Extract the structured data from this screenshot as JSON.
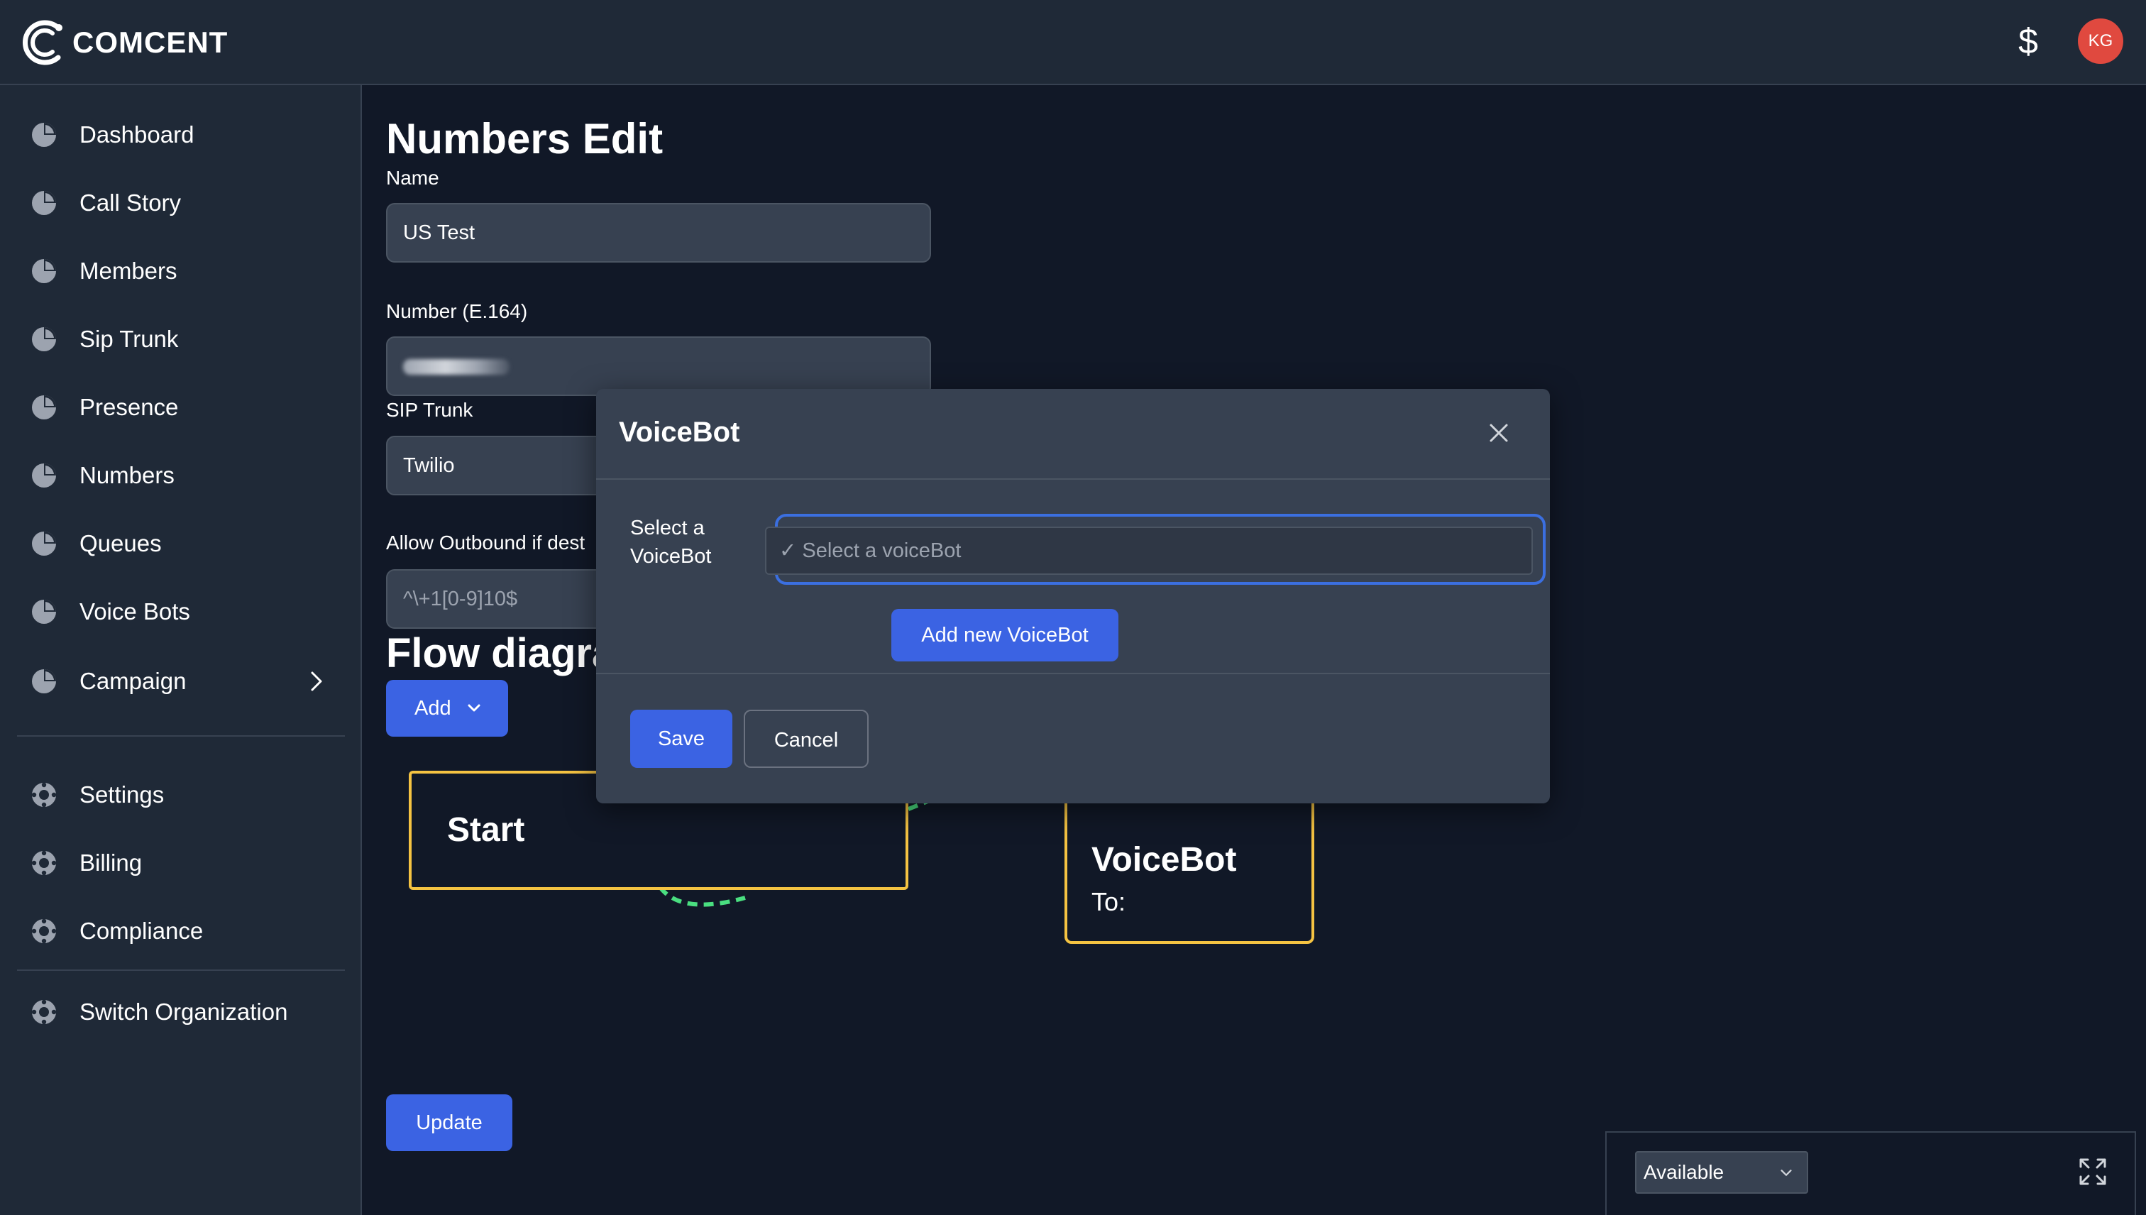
{
  "app": {
    "logo_text": "COMCENT"
  },
  "header": {
    "billing_icon": "dollar-icon",
    "avatar_initials": "KG",
    "avatar_color": "#e0493f"
  },
  "sidebar": {
    "items": [
      {
        "label": "Dashboard",
        "icon": "pie-chart-icon"
      },
      {
        "label": "Call Story",
        "icon": "pie-chart-icon"
      },
      {
        "label": "Members",
        "icon": "pie-chart-icon"
      },
      {
        "label": "Sip Trunk",
        "icon": "pie-chart-icon"
      },
      {
        "label": "Presence",
        "icon": "pie-chart-icon"
      },
      {
        "label": "Numbers",
        "icon": "pie-chart-icon"
      },
      {
        "label": "Queues",
        "icon": "pie-chart-icon"
      },
      {
        "label": "Voice Bots",
        "icon": "pie-chart-icon"
      },
      {
        "label": "Campaign",
        "icon": "pie-chart-icon",
        "has_submenu": true
      }
    ],
    "secondary_items": [
      {
        "label": "Settings",
        "icon": "lifebuoy-icon"
      },
      {
        "label": "Billing",
        "icon": "lifebuoy-icon"
      },
      {
        "label": "Compliance",
        "icon": "lifebuoy-icon"
      }
    ],
    "tertiary_items": [
      {
        "label": "Switch Organization",
        "icon": "lifebuoy-icon"
      }
    ]
  },
  "main": {
    "title": "Numbers Edit",
    "name_label": "Name",
    "name_value": "US Test",
    "number_label": "Number (E.164)",
    "sip_trunk_label": "SIP Trunk",
    "sip_trunk_value": "Twilio",
    "outbound_label": "Allow Outbound if dest",
    "outbound_placeholder": "^\\+1[0-9]10$",
    "flow_title": "Flow diagra",
    "add_button": "Add",
    "update_button": "Update"
  },
  "flow": {
    "start_node": "Start",
    "voicebot_node_title": "VoiceBot",
    "voicebot_node_sub": "To:",
    "node_border_color": "#f5c342",
    "connector_color": "#4ade80"
  },
  "modal": {
    "title": "VoiceBot",
    "select_label": "Select a VoiceBot",
    "select_placeholder": "✓ Select a voiceBot",
    "add_new_button": "Add new VoiceBot",
    "save_button": "Save",
    "cancel_button": "Cancel"
  },
  "status": {
    "value": "Available"
  },
  "colors": {
    "accent": "#3b63e3",
    "background": "#111827",
    "panel": "#1f2937"
  }
}
